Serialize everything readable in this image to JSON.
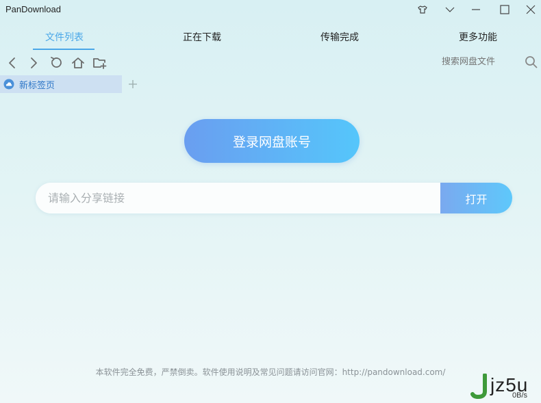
{
  "window": {
    "title": "PanDownload",
    "controls": [
      "skin-icon",
      "dropdown-icon",
      "minimize-icon",
      "maximize-icon",
      "close-icon"
    ]
  },
  "tabs": [
    {
      "label": "文件列表",
      "active": true
    },
    {
      "label": "正在下载",
      "active": false
    },
    {
      "label": "传输完成",
      "active": false
    },
    {
      "label": "更多功能",
      "active": false
    }
  ],
  "toolbar": {
    "buttons": [
      "back-icon",
      "forward-icon",
      "refresh-icon",
      "home-icon",
      "new-folder-icon"
    ],
    "search_placeholder": "搜索网盘文件"
  },
  "page_tab": {
    "label": "新标签页"
  },
  "main": {
    "login_label": "登录网盘账号",
    "share_placeholder": "请输入分享链接",
    "open_label": "打开"
  },
  "footer": {
    "notice": "本软件完全免费，严禁倒卖。软件使用说明及常见问题请访问官网：http://pandownload.com/",
    "speed": "0B/s"
  },
  "watermark": {
    "text": "jz5u"
  },
  "colors": {
    "accent": "#4aa7e8",
    "button_gradient_start": "#6a9ef0",
    "button_gradient_end": "#55c6fb",
    "background": "#d8f0f3"
  }
}
